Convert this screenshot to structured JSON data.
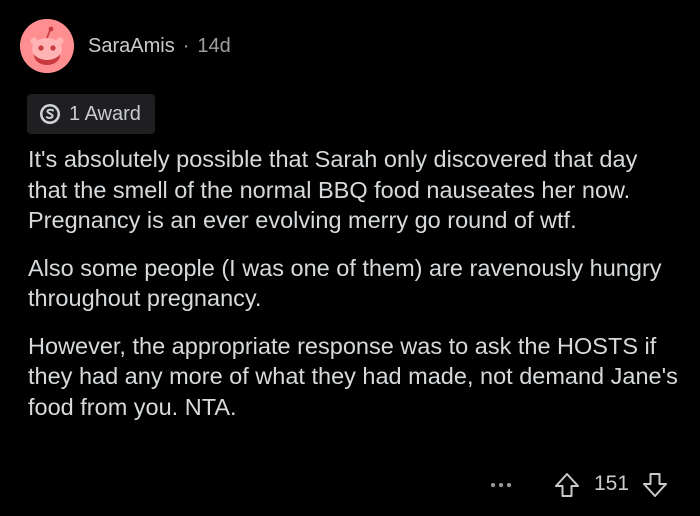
{
  "comment": {
    "username": "SaraAmis",
    "separator": "·",
    "age": "14d",
    "award_label": "1 Award",
    "paragraphs": [
      "It's absolutely possible that Sarah only discovered that day that the smell of the normal BBQ food nauseates her now. Pregnancy is an ever evolving merry go round of wtf.",
      "Also some people (I was one of them) are ravenously hungry throughout pregnancy.",
      "However, the appropriate response was to ask the HOSTS if they had any more of what they had made, not demand Jane's food from you. NTA."
    ],
    "vote_count": "151"
  },
  "icons": {
    "avatar": "snoo-avatar-icon",
    "award": "silver-award-icon",
    "more": "more-options-icon",
    "upvote": "upvote-arrow-icon",
    "downvote": "downvote-arrow-icon"
  },
  "colors": {
    "background": "#000000",
    "text": "#d7dadc",
    "meta": "#9a9ea1",
    "avatar_bg": "#ff8e90",
    "award_bg": "#1f1f21"
  }
}
